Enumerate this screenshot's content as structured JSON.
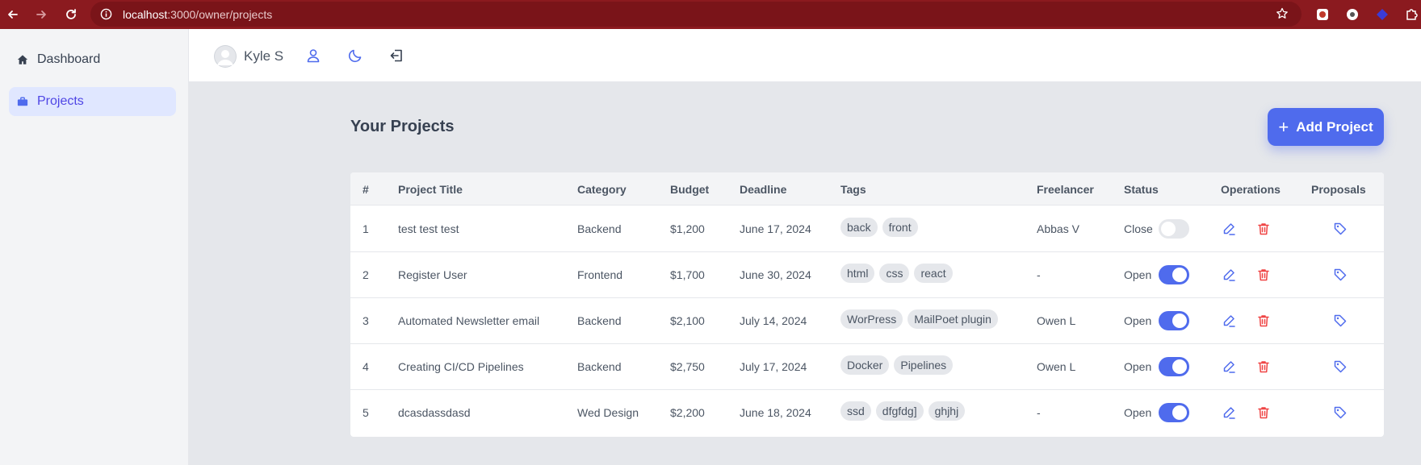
{
  "browser": {
    "url_host": "localhost",
    "url_path": ":3000/owner/projects"
  },
  "sidebar": {
    "items": [
      {
        "label": "Dashboard",
        "icon": "home-icon",
        "active": false
      },
      {
        "label": "Projects",
        "icon": "briefcase-icon",
        "active": true
      }
    ]
  },
  "header": {
    "user_name": "Kyle S",
    "icons": [
      "user-icon",
      "moon-icon",
      "logout-icon"
    ]
  },
  "main": {
    "title": "Your Projects",
    "add_button_label": "Add Project",
    "accent_color": "#4f6bed",
    "danger_color": "#ef4444"
  },
  "table": {
    "columns": [
      "#",
      "Project Title",
      "Category",
      "Budget",
      "Deadline",
      "Tags",
      "Freelancer",
      "Status",
      "Operations",
      "Proposals"
    ],
    "rows": [
      {
        "num": "1",
        "title": "test test test",
        "category": "Backend",
        "budget": "$1,200",
        "deadline": "June 17, 2024",
        "tags": [
          "back",
          "front"
        ],
        "freelancer": "Abbas V",
        "status": "Close",
        "open": false
      },
      {
        "num": "2",
        "title": "Register User",
        "category": "Frontend",
        "budget": "$1,700",
        "deadline": "June 30, 2024",
        "tags": [
          "html",
          "css",
          "react"
        ],
        "freelancer": "-",
        "status": "Open",
        "open": true
      },
      {
        "num": "3",
        "title": "Automated Newsletter email",
        "category": "Backend",
        "budget": "$2,100",
        "deadline": "July 14, 2024",
        "tags": [
          "WorPress",
          "MailPoet plugin"
        ],
        "freelancer": "Owen L",
        "status": "Open",
        "open": true
      },
      {
        "num": "4",
        "title": "Creating CI/CD Pipelines",
        "category": "Backend",
        "budget": "$2,750",
        "deadline": "July 17, 2024",
        "tags": [
          "Docker",
          "Pipelines"
        ],
        "freelancer": "Owen L",
        "status": "Open",
        "open": true
      },
      {
        "num": "5",
        "title": "dcasdassdasd",
        "category": "Wed Design",
        "budget": "$2,200",
        "deadline": "June 18, 2024",
        "tags": [
          "ssd",
          "dfgfdg]",
          "ghjhj"
        ],
        "freelancer": "-",
        "status": "Open",
        "open": true
      }
    ]
  }
}
